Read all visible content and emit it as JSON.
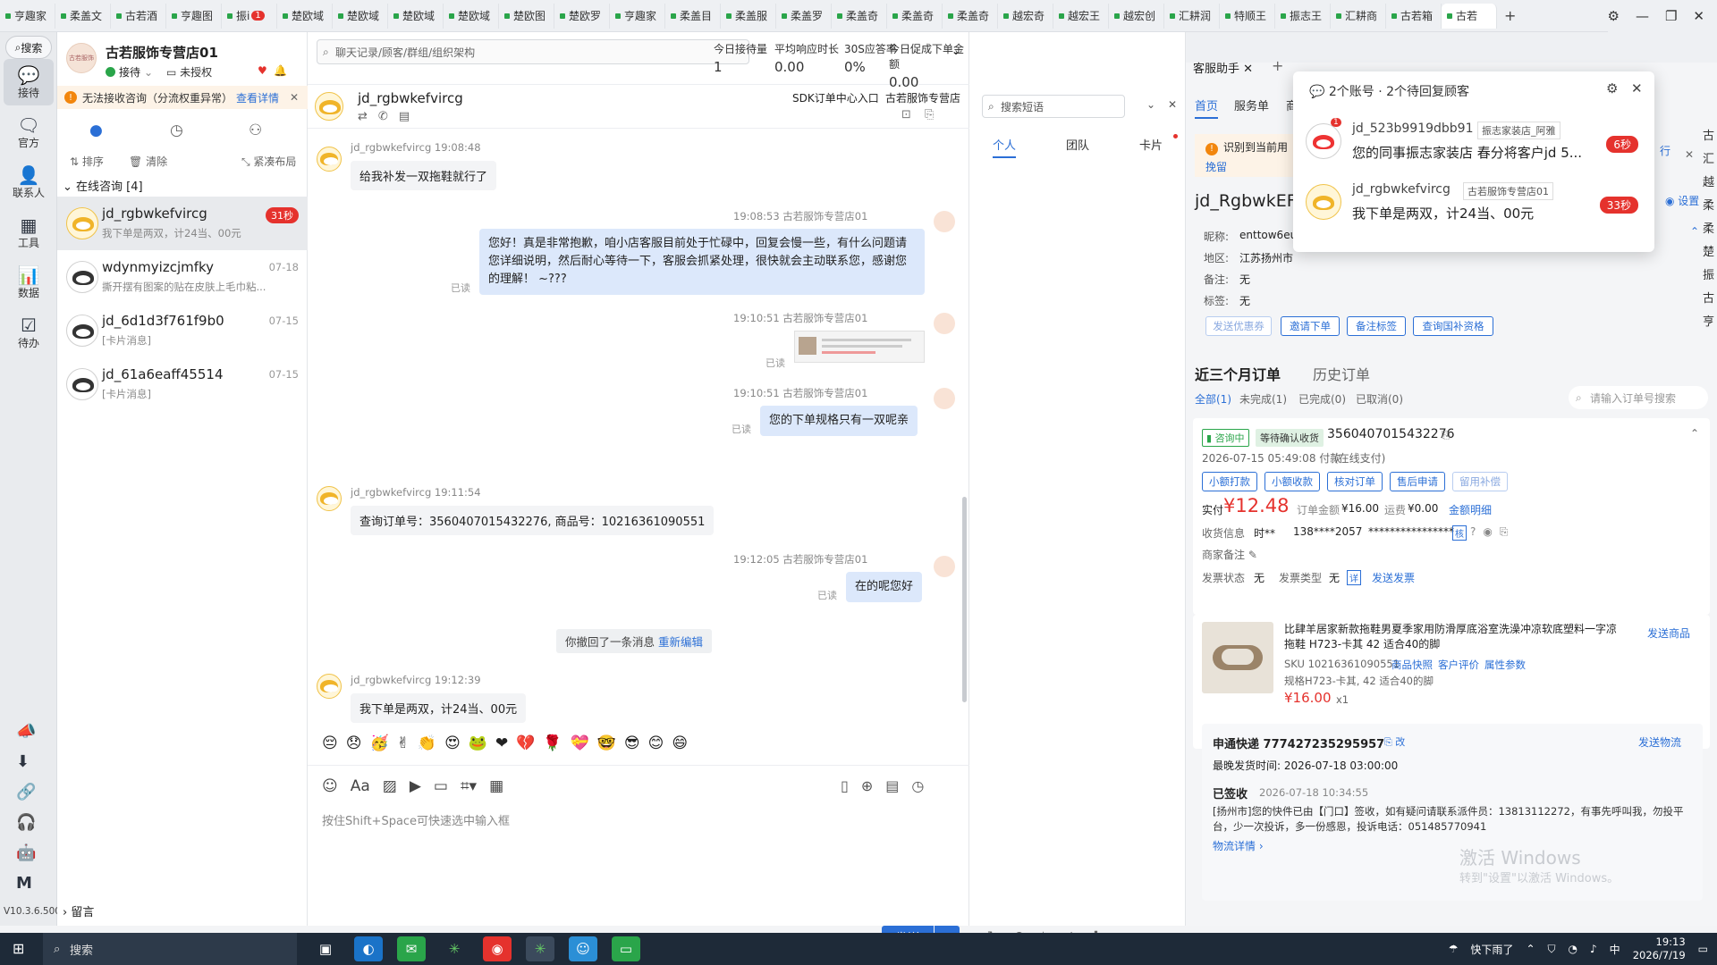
{
  "tabs": [
    "亨趣家",
    "柔盖文",
    "古若酒",
    "亨趣图",
    "振i",
    "楚欧域",
    "楚欧域",
    "楚欧域",
    "楚欧域",
    "楚欧图",
    "楚欧罗",
    "亨趣家",
    "柔盖目",
    "柔盖服",
    "柔盖罗",
    "柔盖奇",
    "柔盖奇",
    "柔盖奇",
    "越宏奇",
    "越宏王",
    "越宏创",
    "汇耕润",
    "特顺王",
    "振志王",
    "汇耕商",
    "古若箱",
    "古若"
  ],
  "tab_badge": "1",
  "rail": {
    "search": "搜索",
    "items": [
      "接待",
      "官方",
      "联系人",
      "工具",
      "数据",
      "待办"
    ],
    "version": "V10.3.6.500"
  },
  "shop": {
    "name": "古若服饰专营店01",
    "logo_text": "古若服饰",
    "status": "接待",
    "auth": "未授权"
  },
  "warn": {
    "text": "无法接收咨询（分流权重异常）",
    "link": "查看详情"
  },
  "list_tools": {
    "sort": "排序",
    "clear": "清除",
    "layout": "紧凑布局"
  },
  "list_header": "在线咨询 [4]",
  "conversations": [
    {
      "name": "jd_rgbwkefvircg",
      "sub": "我下单是两双，计24当、00元",
      "badge": "31秒"
    },
    {
      "name": "wdynmyizcjmfky",
      "sub": "撕开摆有图案的贴在皮肤上毛巾粘...",
      "time": "07-18"
    },
    {
      "name": "jd_6d1d3f761f9b0",
      "sub": "[卡片消息]",
      "time": "07-15"
    },
    {
      "name": "jd_61a6eaff45514",
      "sub": "[卡片消息]",
      "time": "07-15"
    }
  ],
  "leave_msg": "留言",
  "chat": {
    "search_placeholder": "聊天记录/顾客/群组/组织架构",
    "stats": [
      {
        "label": "今日接待量",
        "value": "1"
      },
      {
        "label": "平均响应时长",
        "value": "0.00"
      },
      {
        "label": "30S应答率",
        "value": "0%"
      },
      {
        "label": "今日促成下单金额",
        "value": "0.00"
      }
    ],
    "customer": "jd_rgbwkefvircg",
    "sdk": "SDK订单中心入口",
    "shop_short": "古若服饰专营店",
    "messages": [
      {
        "meta": "jd_rgbwkefvircg  19:08:48",
        "text": "给我补发一双拖鞋就行了"
      },
      {
        "meta": "19:08:53  古若服饰专营店01",
        "text": "您好！真是非常抱歉，咱小店客服目前处于忙碌中，回复会慢一些，有什么问题请您详细说明，然后耐心等待一下，客服会抓紧处理，很快就会主动联系您，感谢您的理解！ ~???"
      },
      {
        "meta": "19:10:51  古若服饰专营店01"
      },
      {
        "meta": "19:10:51  古若服饰专营店01",
        "text": "您的下单规格只有一双呢亲"
      },
      {
        "meta": "jd_rgbwkefvircg  19:11:54",
        "text": "查询订单号：3560407015432276, 商品号：10216361090551"
      },
      {
        "meta": "19:12:05  古若服饰专营店01",
        "text": "在的呢您好"
      },
      {
        "meta": "jd_rgbwkefvircg  19:12:39",
        "text": "我下单是两双，计24当、00元"
      }
    ],
    "read": "已读",
    "recall": "你撤回了一条消息",
    "reedit": "重新编辑",
    "emojis": [
      "😔",
      "😞",
      "🥳",
      "✌",
      "👏",
      "😍",
      "🐸",
      "❤",
      "💔",
      "🌹",
      "💝",
      "🤓",
      "😎",
      "😊",
      "😄"
    ],
    "input_placeholder": "按住Shift+Space可快速选中输入框",
    "send": "发送",
    "watermark": "古若服饰专营店01"
  },
  "quick": {
    "search_placeholder": "搜索短语",
    "tabs": [
      "个人",
      "团队",
      "卡片"
    ]
  },
  "assist": {
    "title": "客服助手",
    "tabs": [
      "首页",
      "服务单",
      "商"
    ],
    "notice": "识别到当前用",
    "notice_cont": "挽留",
    "notice_right": "行",
    "customer": "jd_RgbwkEFv",
    "setting": "设置",
    "nickname_label": "昵称:",
    "nickname": "enttow6eu",
    "region_label": "地区:",
    "region": "江苏扬州市",
    "note_label": "备注:",
    "note": "无",
    "tag_label": "标签:",
    "tag": "无",
    "actions": [
      "发送优惠券",
      "邀请下单",
      "备注标签",
      "查询国补资格"
    ],
    "order_tabs": [
      "近三个月订单",
      "历史订单"
    ],
    "filters": [
      "全部(1)",
      "未完成(1)",
      "已完成(0)",
      "已取消(0)"
    ],
    "order_search": "请输入订单号搜索",
    "order": {
      "status1": "咨询中",
      "status2": "等待确认收货",
      "id": "3560407015432276",
      "time": "2026-07-15 05:49:08 付款",
      "pay": "(在线支付)",
      "ops": [
        "小额打款",
        "小额收款",
        "核对订单",
        "售后申请",
        "留用补偿"
      ],
      "paid_label": "实付",
      "paid": "¥12.48",
      "amount_label": "订单金额",
      "amount": "¥16.00",
      "freight_label": "运费",
      "freight": "¥0.00",
      "detail": "金额明细",
      "recv_label": "收货信息",
      "recv_name": "时**",
      "recv_phone": "138****2057",
      "recv_addr": "****************",
      "recv_verify": "核",
      "merchant_note": "商家备注",
      "invoice_label": "发票状态",
      "invoice": "无",
      "invoice_type_label": "发票类型",
      "invoice_type": "无",
      "invoice_detail": "详",
      "send_invoice": "发送发票",
      "product": "比肆羊居家新款拖鞋男夏季家用防滑厚底浴室洗澡冲凉软底塑料一字凉拖鞋 H723-卡其 42 适合40的脚",
      "send_product": "发送商品",
      "sku": "SKU 10216361090551",
      "sku_links": [
        "商品快照",
        "客户评价",
        "属性参数"
      ],
      "spec": "规格H723-卡其, 42 适合40的脚",
      "price": "¥16.00",
      "qty": "x1",
      "express": "申通快递 777427235295957",
      "express_edit": "改",
      "send_logistics": "发送物流",
      "latest_ship": "最晚发货时间:  2026-07-18 03:00:00",
      "signed": "已签收",
      "signed_time": "2026-07-18 10:34:55",
      "track": "[扬州市]您的快件已由【门口】签收，如有疑问请联系派件员：13813112272，有事先呼叫我，勿投平台，少一次投诉，多一份感恩，投诉电话：051485770941",
      "track_link": "物流详情"
    }
  },
  "popup": {
    "title": "2个账号 · 2个待回复顾客",
    "items": [
      {
        "name": "jd_523b9919dbb91",
        "shop": "振志家装店_阿雅",
        "text": "您的同事振志家装店 春分将客户jd 5...",
        "badge": "6秒",
        "unread": "1"
      },
      {
        "name": "jd_rgbwkefvircg",
        "shop": "古若服饰专营店01",
        "text": "我下单是两双，计24当、00元",
        "badge": "33秒"
      }
    ]
  },
  "far_right_tabs": [
    "古",
    "汇",
    "越",
    "柔",
    "柔",
    "楚",
    "振",
    "古",
    "亨"
  ],
  "taskbar": {
    "search": "搜索",
    "weather": "快下雨了",
    "ime": "中",
    "time": "19:13",
    "date": "2026/7/19"
  },
  "activation": {
    "title": "激活 Windows",
    "sub": "转到\"设置\"以激活 Windows。"
  }
}
